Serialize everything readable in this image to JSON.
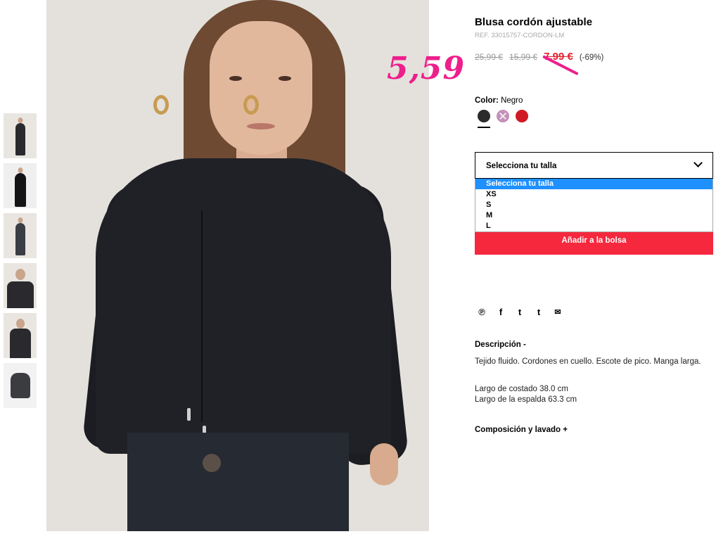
{
  "product": {
    "title": "Blusa cordón ajustable",
    "ref": "REF. 33015757-CORDON-LM"
  },
  "prices": {
    "original": "25,99 €",
    "previous": "15,99 €",
    "current": "7,99 €",
    "discount": "(-69%)",
    "handwritten_note": "5,59"
  },
  "color": {
    "label": "Color:",
    "selected": "Negro",
    "options": [
      {
        "name": "black",
        "hex": "#2b2b2b"
      },
      {
        "name": "lilac",
        "hex": "#c48fbb"
      },
      {
        "name": "red",
        "hex": "#cf1a25"
      }
    ]
  },
  "size_select": {
    "label": "Selecciona tu talla",
    "options": [
      "Selecciona tu talla",
      "XS",
      "S",
      "M",
      "L"
    ],
    "selected_index": 0
  },
  "add_button": "Añadir a la bolsa",
  "social_icons": [
    "pinterest-icon",
    "facebook-icon",
    "twitter-icon",
    "tumblr-icon",
    "email-icon"
  ],
  "social_glyphs": [
    "℗",
    "f",
    "t",
    "t",
    "✉"
  ],
  "description": {
    "heading": "Descripción  -",
    "text": "Tejido fluido. Cordones en cuello. Escote de pico. Manga larga.",
    "measure_1": "Largo de costado 38.0 cm",
    "measure_2": "Largo de la espalda 63.3 cm"
  },
  "composition_heading": "Composición y lavado  +",
  "thumbnails": [
    "thumbnail-1",
    "thumbnail-2",
    "thumbnail-3",
    "thumbnail-4",
    "thumbnail-5",
    "thumbnail-6"
  ]
}
